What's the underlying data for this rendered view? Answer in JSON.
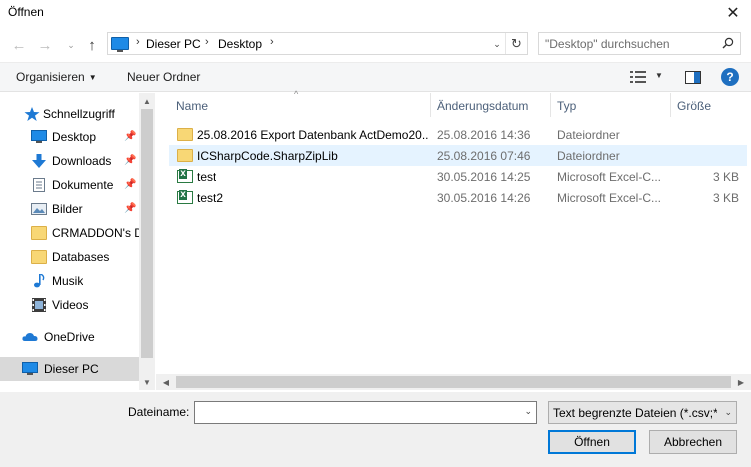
{
  "window": {
    "title": "Öffnen",
    "close_glyph": "✕"
  },
  "nav": {
    "back_glyph": "←",
    "forward_glyph": "→",
    "recent_glyph": "⌄",
    "up_glyph": "↑",
    "breadcrumb": [
      "Dieser PC",
      "Desktop"
    ],
    "sep_glyph": "›",
    "dropdown_glyph": "⌄",
    "refresh_glyph": "↻",
    "search_placeholder": "\"Desktop\" durchsuchen"
  },
  "toolbar": {
    "organize_label": "Organisieren",
    "organize_caret": "▼",
    "new_folder_label": "Neuer Ordner",
    "view_caret": "▼",
    "help_label": "?"
  },
  "sidebar": {
    "items": [
      {
        "label": "Schnellzugriff",
        "icon": "star-icon",
        "pinned": false
      },
      {
        "label": "Desktop",
        "icon": "desktop-icon",
        "pinned": true
      },
      {
        "label": "Downloads",
        "icon": "download-icon",
        "pinned": true
      },
      {
        "label": "Dokumente",
        "icon": "document-icon",
        "pinned": true
      },
      {
        "label": "Bilder",
        "icon": "pictures-icon",
        "pinned": true
      },
      {
        "label": "CRMADDON's D",
        "icon": "folder-icon",
        "pinned": false
      },
      {
        "label": "Databases",
        "icon": "folder-icon",
        "pinned": false
      },
      {
        "label": "Musik",
        "icon": "music-icon",
        "pinned": false
      },
      {
        "label": "Videos",
        "icon": "video-icon",
        "pinned": false
      },
      {
        "label": "OneDrive",
        "icon": "onedrive-icon",
        "pinned": false
      },
      {
        "label": "Dieser PC",
        "icon": "pc-icon",
        "pinned": false,
        "selected": true
      }
    ],
    "pin_glyph": "📌",
    "scroll_up": "▲",
    "scroll_down": "▼"
  },
  "filelist": {
    "columns": {
      "name": "Name",
      "modified": "Änderungsdatum",
      "type": "Typ",
      "size": "Größe"
    },
    "sort_glyph": "^",
    "rows": [
      {
        "name": "25.08.2016 Export Datenbank ActDemo20...",
        "modified": "25.08.2016 14:36",
        "type": "Dateiordner",
        "size": "",
        "kind": "folder"
      },
      {
        "name": "ICSharpCode.SharpZipLib",
        "modified": "25.08.2016 07:46",
        "type": "Dateiordner",
        "size": "",
        "kind": "folder",
        "selected": true
      },
      {
        "name": "test",
        "modified": "30.05.2016 14:25",
        "type": "Microsoft Excel-C...",
        "size": "3 KB",
        "kind": "excel"
      },
      {
        "name": "test2",
        "modified": "30.05.2016 14:26",
        "type": "Microsoft Excel-C...",
        "size": "3 KB",
        "kind": "excel"
      }
    ],
    "scroll_left": "◀",
    "scroll_right": "▶"
  },
  "footer": {
    "filename_label": "Dateiname:",
    "filename_value": "",
    "filename_caret": "⌄",
    "filter_value": "Text begrenzte Dateien (*.csv;*.t",
    "filter_caret": "⌄",
    "open_label": "Öffnen",
    "cancel_label": "Abbrechen"
  }
}
